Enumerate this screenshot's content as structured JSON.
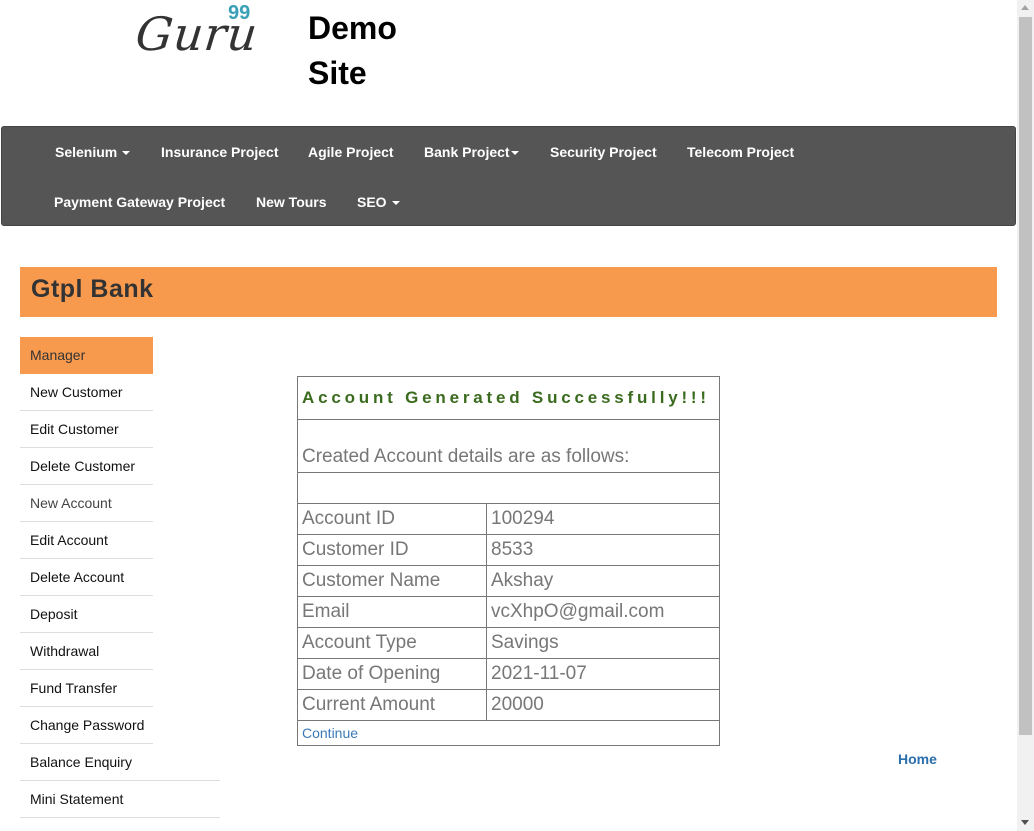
{
  "header": {
    "logo_text": "Guru",
    "logo_sup": "99",
    "site_title": "Demo Site"
  },
  "navbar": {
    "items": [
      {
        "label": "Selenium",
        "dropdown": true
      },
      {
        "label": "Insurance Project",
        "dropdown": false
      },
      {
        "label": "Agile Project",
        "dropdown": false
      },
      {
        "label": "Bank Project",
        "dropdown": true
      },
      {
        "label": "Security Project",
        "dropdown": false
      },
      {
        "label": "Telecom Project",
        "dropdown": false
      },
      {
        "label": "Payment Gateway Project",
        "dropdown": false
      },
      {
        "label": "New Tours",
        "dropdown": false
      },
      {
        "label": "SEO",
        "dropdown": true
      }
    ]
  },
  "bank": {
    "title": "Gtpl Bank"
  },
  "sidebar": {
    "items": [
      {
        "label": "Manager"
      },
      {
        "label": "New Customer"
      },
      {
        "label": "Edit Customer"
      },
      {
        "label": "Delete Customer"
      },
      {
        "label": "New Account"
      },
      {
        "label": "Edit Account"
      },
      {
        "label": "Delete Account"
      },
      {
        "label": "Deposit"
      },
      {
        "label": "Withdrawal"
      },
      {
        "label": "Fund Transfer"
      },
      {
        "label": "Change Password"
      },
      {
        "label": "Balance Enquiry"
      },
      {
        "label": "Mini Statement"
      }
    ]
  },
  "account": {
    "heading": "Account Generated Successfully!!!",
    "subheading": "Created Account details are as follows:",
    "rows": [
      {
        "key": "Account ID",
        "value": "100294"
      },
      {
        "key": "Customer ID",
        "value": "8533"
      },
      {
        "key": "Customer Name",
        "value": "Akshay"
      },
      {
        "key": "Email",
        "value": "vcXhpO@gmail.com"
      },
      {
        "key": "Account Type",
        "value": "Savings"
      },
      {
        "key": "Date of Opening",
        "value": "2021-11-07"
      },
      {
        "key": "Current Amount",
        "value": "20000"
      }
    ],
    "continue_label": "Continue"
  },
  "footer": {
    "home_label": "Home"
  },
  "colors": {
    "navbar_bg": "#555555",
    "accent_orange": "#f89a4e",
    "success_green": "#3a6b1e",
    "link_blue": "#3a7ab8"
  }
}
